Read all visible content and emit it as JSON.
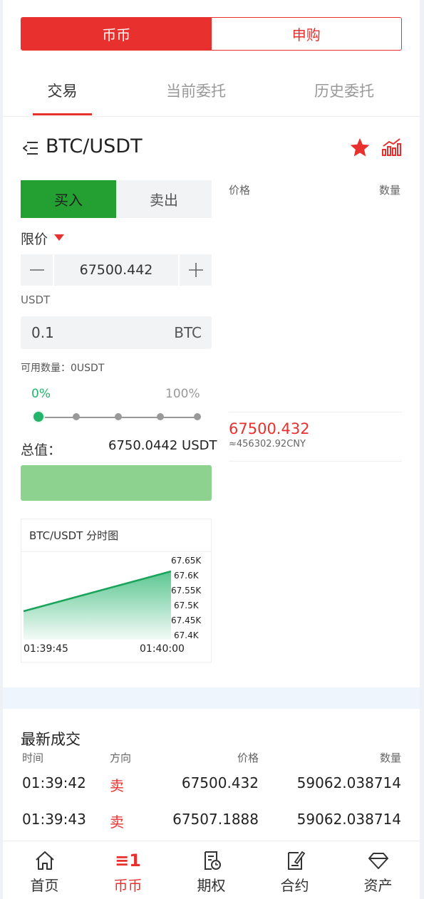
{
  "colors": {
    "accent": "#e8312f",
    "buy": "#24a033",
    "up": "#24b36b",
    "submit_disabled": "#8dd28f",
    "divider": "#eff5fc"
  },
  "top_switch": {
    "spot": "币币",
    "subscribe": "申购"
  },
  "tabs": [
    "交易",
    "当前委托",
    "历史委托"
  ],
  "pair": {
    "name": "BTC/USDT",
    "menu_icon": "menu-left-icon",
    "favorite_icon": "star-icon",
    "chart_icon": "kline-chart-icon"
  },
  "order": {
    "buy_label": "买入",
    "sell_label": "卖出",
    "type_label": "限价",
    "price": "67500.442",
    "price_unit": "USDT",
    "quantity": "0.1",
    "quantity_unit": "BTC",
    "available": "可用数量：0USDT",
    "pct_min": "0%",
    "pct_max": "100%",
    "slider_level": 0,
    "total_label": "总值：",
    "total_value": "6750.0442 USDT"
  },
  "orderbook": {
    "price_header": "价格",
    "amount_header": "数量",
    "last_price": "67500.432",
    "last_price_cny": "≈456302.92CNY"
  },
  "mini_chart": {
    "title": "BTC/USDT 分时图",
    "y_ticks": [
      "67.65K",
      "67.6K",
      "67.55K",
      "67.5K",
      "67.45K",
      "67.4K"
    ],
    "x_ticks": [
      "01:39:45",
      "01:40:00"
    ]
  },
  "trades": {
    "title": "最新成交",
    "headers": [
      "时间",
      "方向",
      "价格",
      "数量"
    ],
    "rows": [
      [
        "01:39:42",
        "卖",
        "67500.432",
        "59062.038714"
      ],
      [
        "01:39:43",
        "卖",
        "67507.1888",
        "59062.038714"
      ]
    ]
  },
  "nav": [
    {
      "label": "首页",
      "icon": "home-icon"
    },
    {
      "label": "币币",
      "icon": "spot-icon",
      "glyph": "≡1",
      "active": true
    },
    {
      "label": "期权",
      "icon": "options-icon"
    },
    {
      "label": "合约",
      "icon": "contract-icon"
    },
    {
      "label": "资产",
      "icon": "diamond-icon"
    }
  ]
}
